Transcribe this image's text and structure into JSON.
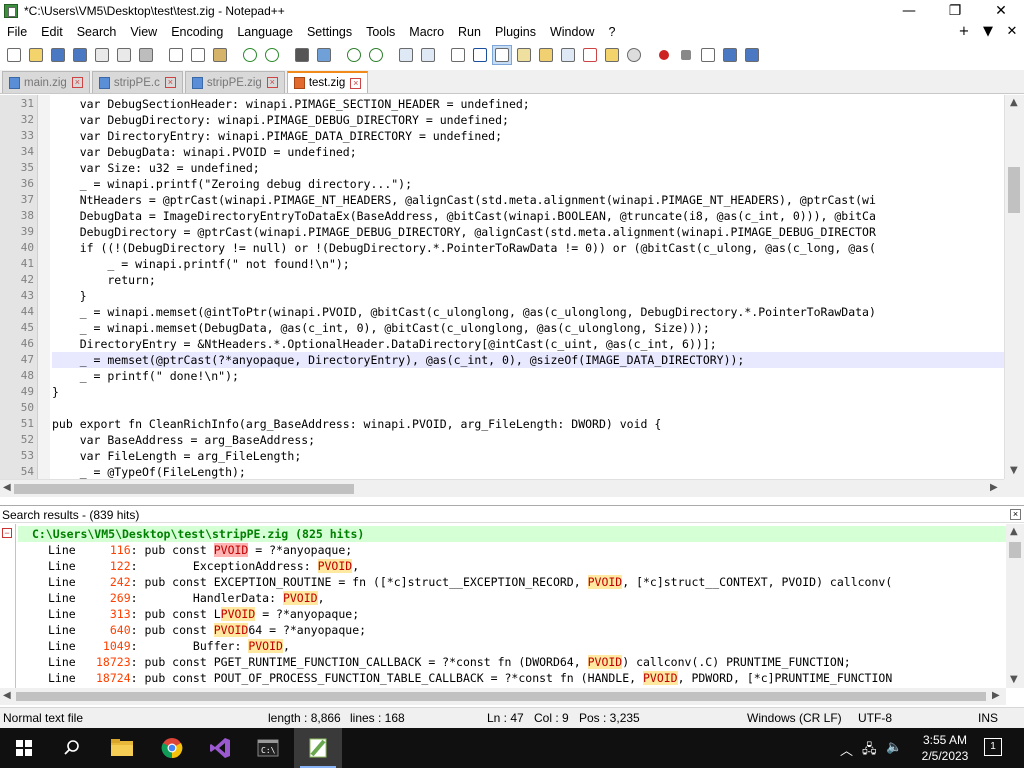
{
  "window": {
    "title": "*C:\\Users\\VM5\\Desktop\\test\\test.zig - Notepad++",
    "minimize": "—",
    "maximize": "❐",
    "close": "✕"
  },
  "menu": {
    "items": [
      "File",
      "Edit",
      "Search",
      "View",
      "Encoding",
      "Language",
      "Settings",
      "Tools",
      "Macro",
      "Run",
      "Plugins",
      "Window",
      "?"
    ],
    "right": [
      "+",
      "▼",
      "✕"
    ]
  },
  "tabs": [
    {
      "label": "main.zig",
      "active": false
    },
    {
      "label": "stripPE.c",
      "active": false
    },
    {
      "label": "stripPE.zig",
      "active": false
    },
    {
      "label": "test.zig",
      "active": true
    }
  ],
  "editor": {
    "current_line": 47,
    "lines": [
      {
        "n": "31",
        "t": "    var DebugSectionHeader: winapi.PIMAGE_SECTION_HEADER = undefined;"
      },
      {
        "n": "32",
        "t": "    var DebugDirectory: winapi.PIMAGE_DEBUG_DIRECTORY = undefined;"
      },
      {
        "n": "33",
        "t": "    var DirectoryEntry: winapi.PIMAGE_DATA_DIRECTORY = undefined;"
      },
      {
        "n": "34",
        "t": "    var DebugData: winapi.PVOID = undefined;"
      },
      {
        "n": "35",
        "t": "    var Size: u32 = undefined;"
      },
      {
        "n": "36",
        "t": "    _ = winapi.printf(\"Zeroing debug directory...\");"
      },
      {
        "n": "37",
        "t": "    NtHeaders = @ptrCast(winapi.PIMAGE_NT_HEADERS, @alignCast(std.meta.alignment(winapi.PIMAGE_NT_HEADERS), @ptrCast(wi"
      },
      {
        "n": "38",
        "t": "    DebugData = ImageDirectoryEntryToDataEx(BaseAddress, @bitCast(winapi.BOOLEAN, @truncate(i8, @as(c_int, 0))), @bitCa"
      },
      {
        "n": "39",
        "t": "    DebugDirectory = @ptrCast(winapi.PIMAGE_DEBUG_DIRECTORY, @alignCast(std.meta.alignment(winapi.PIMAGE_DEBUG_DIRECTOR"
      },
      {
        "n": "40",
        "t": "    if ((!(DebugDirectory != null) or !(DebugDirectory.*.PointerToRawData != 0)) or (@bitCast(c_ulong, @as(c_long, @as("
      },
      {
        "n": "41",
        "t": "        _ = winapi.printf(\" not found!\\n\");"
      },
      {
        "n": "42",
        "t": "        return;"
      },
      {
        "n": "43",
        "t": "    }"
      },
      {
        "n": "44",
        "t": "    _ = winapi.memset(@intToPtr(winapi.PVOID, @bitCast(c_ulonglong, @as(c_ulonglong, DebugDirectory.*.PointerToRawData)"
      },
      {
        "n": "45",
        "t": "    _ = winapi.memset(DebugData, @as(c_int, 0), @bitCast(c_ulonglong, @as(c_ulonglong, Size)));"
      },
      {
        "n": "46",
        "t": "    DirectoryEntry = &NtHeaders.*.OptionalHeader.DataDirectory[@intCast(c_uint, @as(c_int, 6))];"
      },
      {
        "n": "47",
        "t": "    _ = memset(@ptrCast(?*anyopaque, DirectoryEntry), @as(c_int, 0), @sizeOf(IMAGE_DATA_DIRECTORY));"
      },
      {
        "n": "48",
        "t": "    _ = printf(\" done!\\n\");"
      },
      {
        "n": "49",
        "t": "}"
      },
      {
        "n": "50",
        "t": ""
      },
      {
        "n": "51",
        "t": "pub export fn CleanRichInfo(arg_BaseAddress: winapi.PVOID, arg_FileLength: DWORD) void {"
      },
      {
        "n": "52",
        "t": "    var BaseAddress = arg_BaseAddress;"
      },
      {
        "n": "53",
        "t": "    var FileLength = arg_FileLength;"
      },
      {
        "n": "54",
        "t": "    _ = @TypeOf(FileLength);"
      }
    ]
  },
  "search_results": {
    "header": "Search results - (839 hits)",
    "file_line": "C:\\Users\\VM5\\Desktop\\test\\stripPE.zig (825 hits)",
    "rows": [
      {
        "line": "116",
        "pre": ": pub const ",
        "hit": "PVOID",
        "post": " = ?*anyopaque;",
        "cur": true
      },
      {
        "line": "122",
        "pre": ":        ExceptionAddress: ",
        "hit": "PVOID",
        "post": ",",
        "cur": false
      },
      {
        "line": "242",
        "pre": ": pub const EXCEPTION_ROUTINE = fn ([*c]struct__EXCEPTION_RECORD, ",
        "hit": "PVOID",
        "post": ", [*c]struct__CONTEXT, PVOID) callconv(",
        "cur": false
      },
      {
        "line": "269",
        "pre": ":        HandlerData: ",
        "hit": "PVOID",
        "post": ",",
        "cur": false
      },
      {
        "line": "313",
        "pre": ": pub const L",
        "hit": "PVOID",
        "post": " = ?*anyopaque;",
        "cur": false
      },
      {
        "line": "640",
        "pre": ": pub const ",
        "hit": "PVOID",
        "post": "64 = ?*anyopaque;",
        "cur": false
      },
      {
        "line": "1049",
        "pre": ":        Buffer: ",
        "hit": "PVOID",
        "post": ",",
        "cur": false
      },
      {
        "line": "18723",
        "pre": ": pub const PGET_RUNTIME_FUNCTION_CALLBACK = ?*const fn (DWORD64, ",
        "hit": "PVOID",
        "post": ") callconv(.C) PRUNTIME_FUNCTION;",
        "cur": false
      },
      {
        "line": "18724",
        "pre": ": pub const POUT_OF_PROCESS_FUNCTION_TABLE_CALLBACK = ?*const fn (HANDLE, ",
        "hit": "PVOID",
        "post": ", PDWORD, [*c]PRUNTIME_FUNCTION",
        "cur": false
      }
    ]
  },
  "status": {
    "filetype": "Normal text file",
    "length": "length : 8,866",
    "lines": "lines : 168",
    "ln": "Ln : 47",
    "col": "Col : 9",
    "pos": "Pos : 3,235",
    "eol": "Windows (CR LF)",
    "encoding": "UTF-8",
    "mode": "INS"
  },
  "taskbar": {
    "time": "3:55 AM",
    "date": "2/5/2023"
  }
}
